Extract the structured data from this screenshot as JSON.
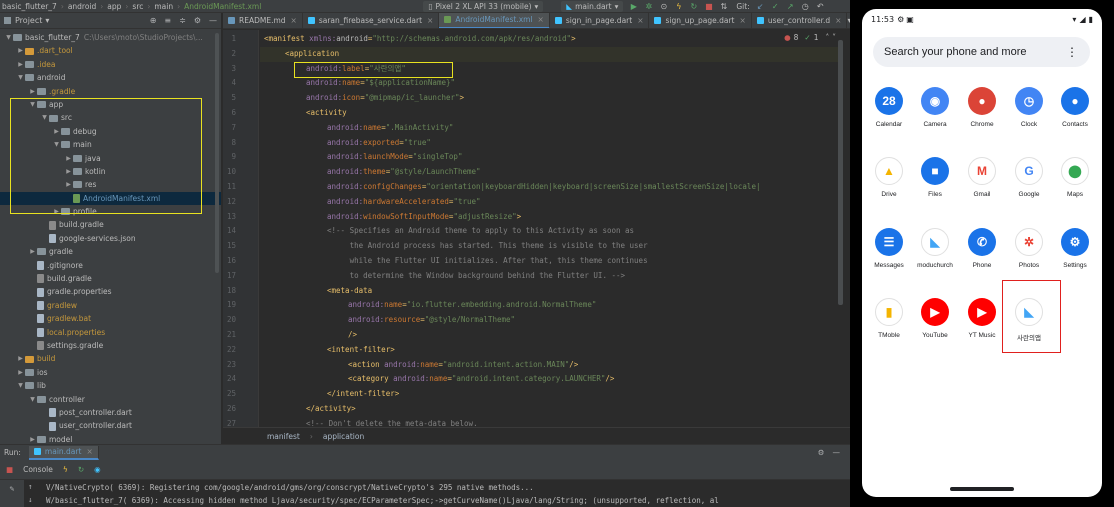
{
  "ide": {
    "navbar": {
      "crumbs": [
        "basic_flutter_7",
        "android",
        "app",
        "src",
        "main",
        "AndroidManifest.xml"
      ],
      "device": "Pixel 2 XL API 33 (mobile)",
      "run_config": "main.dart",
      "git_label": "Git:"
    },
    "project": {
      "title": "Project",
      "tree": [
        {
          "indent": 0,
          "arrow": "down",
          "icon": "folder",
          "label": "basic_flutter_7",
          "extra": "C:\\Users\\moto\\StudioProjects\\..."
        },
        {
          "indent": 1,
          "arrow": "right",
          "icon": "folder-orange",
          "label": ".dart_tool",
          "style": "orange"
        },
        {
          "indent": 1,
          "arrow": "right",
          "icon": "folder",
          "label": ".idea",
          "style": "orange"
        },
        {
          "indent": 1,
          "arrow": "down",
          "icon": "folder",
          "label": "android"
        },
        {
          "indent": 2,
          "arrow": "right",
          "icon": "folder",
          "label": ".gradle",
          "style": "orange"
        },
        {
          "indent": 2,
          "arrow": "down",
          "icon": "folder",
          "label": "app"
        },
        {
          "indent": 3,
          "arrow": "down",
          "icon": "folder",
          "label": "src"
        },
        {
          "indent": 4,
          "arrow": "right",
          "icon": "folder",
          "label": "debug"
        },
        {
          "indent": 4,
          "arrow": "down",
          "icon": "folder",
          "label": "main"
        },
        {
          "indent": 5,
          "arrow": "right",
          "icon": "folder",
          "label": "java"
        },
        {
          "indent": 5,
          "arrow": "right",
          "icon": "folder",
          "label": "kotlin"
        },
        {
          "indent": 5,
          "arrow": "right",
          "icon": "folder",
          "label": "res"
        },
        {
          "indent": 5,
          "arrow": "",
          "icon": "file-green",
          "label": "AndroidManifest.xml",
          "style": "blue",
          "selected": true
        },
        {
          "indent": 4,
          "arrow": "right",
          "icon": "folder",
          "label": "profile"
        },
        {
          "indent": 3,
          "arrow": "",
          "icon": "file-gray",
          "label": "build.gradle"
        },
        {
          "indent": 3,
          "arrow": "",
          "icon": "file",
          "label": "google-services.json"
        },
        {
          "indent": 2,
          "arrow": "right",
          "icon": "folder",
          "label": "gradle"
        },
        {
          "indent": 2,
          "arrow": "",
          "icon": "file",
          "label": ".gitignore"
        },
        {
          "indent": 2,
          "arrow": "",
          "icon": "file-gray",
          "label": "build.gradle"
        },
        {
          "indent": 2,
          "arrow": "",
          "icon": "file",
          "label": "gradle.properties"
        },
        {
          "indent": 2,
          "arrow": "",
          "icon": "file",
          "label": "gradlew",
          "style": "orange"
        },
        {
          "indent": 2,
          "arrow": "",
          "icon": "file",
          "label": "gradlew.bat",
          "style": "orange"
        },
        {
          "indent": 2,
          "arrow": "",
          "icon": "file",
          "label": "local.properties",
          "style": "orange"
        },
        {
          "indent": 2,
          "arrow": "",
          "icon": "file-gray",
          "label": "settings.gradle"
        },
        {
          "indent": 1,
          "arrow": "right",
          "icon": "folder-orange",
          "label": "build",
          "style": "orange"
        },
        {
          "indent": 1,
          "arrow": "right",
          "icon": "folder",
          "label": "ios"
        },
        {
          "indent": 1,
          "arrow": "down",
          "icon": "folder",
          "label": "lib"
        },
        {
          "indent": 2,
          "arrow": "down",
          "icon": "folder",
          "label": "controller"
        },
        {
          "indent": 3,
          "arrow": "",
          "icon": "file",
          "label": "post_controller.dart"
        },
        {
          "indent": 3,
          "arrow": "",
          "icon": "file",
          "label": "user_controller.dart"
        },
        {
          "indent": 2,
          "arrow": "right",
          "icon": "folder",
          "label": "model"
        }
      ]
    },
    "tabs": [
      {
        "label": "README.md",
        "color": "#6897bb"
      },
      {
        "label": "saran_firebase_service.dart",
        "color": "#40c4ff"
      },
      {
        "label": "AndroidManifest.xml",
        "color": "#6a9955",
        "active": true
      },
      {
        "label": "sign_in_page.dart",
        "color": "#40c4ff"
      },
      {
        "label": "sign_up_page.dart",
        "color": "#40c4ff"
      },
      {
        "label": "user_controller.d",
        "color": "#40c4ff"
      }
    ],
    "inspection": {
      "warnings": "8",
      "ok": "1"
    },
    "code_lines": [
      {
        "n": "1",
        "indent": 0,
        "parts": [
          [
            "t-tag",
            "<manifest "
          ],
          [
            "t-ns",
            "xmlns:"
          ],
          [
            "t-attr",
            "android"
          ],
          [
            "t-punct",
            "="
          ],
          [
            "t-str",
            "\"http://schemas.android.com/apk/res/android\""
          ],
          [
            "t-tag",
            ">"
          ]
        ]
      },
      {
        "n": "2",
        "indent": 1,
        "parts": [
          [
            "t-tag",
            "<application"
          ]
        ]
      },
      {
        "n": "3",
        "indent": 2,
        "parts": [
          [
            "t-ns",
            "android:"
          ],
          [
            "t-red",
            "label"
          ],
          [
            "t-punct",
            "="
          ],
          [
            "t-str",
            "\"사란의앱\""
          ]
        ]
      },
      {
        "n": "4",
        "indent": 2,
        "parts": [
          [
            "t-ns",
            "android:"
          ],
          [
            "t-red",
            "name"
          ],
          [
            "t-punct",
            "="
          ],
          [
            "t-str",
            "\"${applicationName}\""
          ]
        ]
      },
      {
        "n": "5",
        "indent": 2,
        "parts": [
          [
            "t-ns",
            "android:"
          ],
          [
            "t-red",
            "icon"
          ],
          [
            "t-punct",
            "="
          ],
          [
            "t-str",
            "\"@mipmap/ic_launcher\""
          ],
          [
            "t-tag",
            ">"
          ]
        ]
      },
      {
        "n": "6",
        "indent": 2,
        "parts": [
          [
            "t-tag",
            "<activity"
          ]
        ]
      },
      {
        "n": "7",
        "indent": 3,
        "parts": [
          [
            "t-ns",
            "android:"
          ],
          [
            "t-red",
            "name"
          ],
          [
            "t-punct",
            "="
          ],
          [
            "t-str",
            "\".MainActivity\""
          ]
        ]
      },
      {
        "n": "8",
        "indent": 3,
        "parts": [
          [
            "t-ns",
            "android:"
          ],
          [
            "t-red",
            "exported"
          ],
          [
            "t-punct",
            "="
          ],
          [
            "t-str",
            "\"true\""
          ]
        ]
      },
      {
        "n": "9",
        "indent": 3,
        "parts": [
          [
            "t-ns",
            "android:"
          ],
          [
            "t-red",
            "launchMode"
          ],
          [
            "t-punct",
            "="
          ],
          [
            "t-str",
            "\"singleTop\""
          ]
        ]
      },
      {
        "n": "10",
        "indent": 3,
        "parts": [
          [
            "t-ns",
            "android:"
          ],
          [
            "t-red",
            "theme"
          ],
          [
            "t-punct",
            "="
          ],
          [
            "t-str",
            "\"@style/LaunchTheme\""
          ]
        ]
      },
      {
        "n": "11",
        "indent": 3,
        "parts": [
          [
            "t-ns",
            "android:"
          ],
          [
            "t-red",
            "configChanges"
          ],
          [
            "t-punct",
            "="
          ],
          [
            "t-str",
            "\"orientation|keyboardHidden|keyboard|screenSize|smallestScreenSize|locale|"
          ]
        ]
      },
      {
        "n": "12",
        "indent": 3,
        "parts": [
          [
            "t-ns",
            "android:"
          ],
          [
            "t-red",
            "hardwareAccelerated"
          ],
          [
            "t-punct",
            "="
          ],
          [
            "t-str",
            "\"true\""
          ]
        ]
      },
      {
        "n": "13",
        "indent": 3,
        "parts": [
          [
            "t-ns",
            "android:"
          ],
          [
            "t-red",
            "windowSoftInputMode"
          ],
          [
            "t-punct",
            "="
          ],
          [
            "t-str",
            "\"adjustResize\""
          ],
          [
            "t-tag",
            ">"
          ]
        ]
      },
      {
        "n": "14",
        "indent": 3,
        "parts": [
          [
            "t-cmt",
            "<!-- Specifies an Android theme to apply to this Activity as soon as"
          ]
        ]
      },
      {
        "n": "15",
        "indent": 3,
        "parts": [
          [
            "t-cmt",
            "     the Android process has started. This theme is visible to the user"
          ]
        ]
      },
      {
        "n": "16",
        "indent": 3,
        "parts": [
          [
            "t-cmt",
            "     while the Flutter UI initializes. After that, this theme continues"
          ]
        ]
      },
      {
        "n": "17",
        "indent": 3,
        "parts": [
          [
            "t-cmt",
            "     to determine the Window background behind the Flutter UI. -->"
          ]
        ]
      },
      {
        "n": "18",
        "indent": 3,
        "parts": [
          [
            "t-tag",
            "<meta-data"
          ]
        ]
      },
      {
        "n": "19",
        "indent": 4,
        "parts": [
          [
            "t-ns",
            "android:"
          ],
          [
            "t-red",
            "name"
          ],
          [
            "t-punct",
            "="
          ],
          [
            "t-str",
            "\"io.flutter.embedding.android.NormalTheme\""
          ]
        ]
      },
      {
        "n": "20",
        "indent": 4,
        "parts": [
          [
            "t-ns",
            "android:"
          ],
          [
            "t-red",
            "resource"
          ],
          [
            "t-punct",
            "="
          ],
          [
            "t-str",
            "\"@style/NormalTheme\""
          ]
        ]
      },
      {
        "n": "21",
        "indent": 4,
        "parts": [
          [
            "t-tag",
            "/>"
          ]
        ]
      },
      {
        "n": "22",
        "indent": 3,
        "parts": [
          [
            "t-tag",
            "<intent-filter>"
          ]
        ]
      },
      {
        "n": "23",
        "indent": 4,
        "parts": [
          [
            "t-tag",
            "<action "
          ],
          [
            "t-ns",
            "android:"
          ],
          [
            "t-red",
            "name"
          ],
          [
            "t-punct",
            "="
          ],
          [
            "t-str",
            "\"android.intent.action.MAIN\""
          ],
          [
            "t-tag",
            "/>"
          ]
        ]
      },
      {
        "n": "24",
        "indent": 4,
        "parts": [
          [
            "t-tag",
            "<category "
          ],
          [
            "t-ns",
            "android:"
          ],
          [
            "t-red",
            "name"
          ],
          [
            "t-punct",
            "="
          ],
          [
            "t-str",
            "\"android.intent.category.LAUNCHER\""
          ],
          [
            "t-tag",
            "/>"
          ]
        ]
      },
      {
        "n": "25",
        "indent": 3,
        "parts": [
          [
            "t-tag",
            "</intent-filter>"
          ]
        ]
      },
      {
        "n": "26",
        "indent": 2,
        "parts": [
          [
            "t-tag",
            "</activity>"
          ]
        ]
      },
      {
        "n": "27",
        "indent": 2,
        "parts": [
          [
            "t-cmt",
            "<!-- Don't delete the meta-data below."
          ]
        ]
      }
    ],
    "breadcrumbs": [
      "manifest",
      "application"
    ],
    "run": {
      "label": "Run:",
      "config": "main.dart",
      "console_tab": "Console"
    },
    "console_lines": [
      "V/NativeCrypto( 6369): Registering com/google/android/gms/org/conscrypt/NativeCrypto's 295 native methods...",
      "W/basic_flutter_7( 6369): Accessing hidden method Ljava/security/spec/ECParameterSpec;->getCurveName()Ljava/lang/String; (unsupported, reflection, al"
    ]
  },
  "phone": {
    "time": "11:53",
    "search_placeholder": "Search your phone and more",
    "apps": [
      {
        "name": "Calendar",
        "icon": "calendar-icon",
        "bg": "#1a73e8",
        "glyph": "28"
      },
      {
        "name": "Camera",
        "icon": "camera-icon",
        "bg": "#4285f4",
        "glyph": "◉"
      },
      {
        "name": "Chrome",
        "icon": "chrome-icon",
        "bg": "#db4437",
        "glyph": "●"
      },
      {
        "name": "Clock",
        "icon": "clock-icon",
        "bg": "#4285f4",
        "glyph": "◷"
      },
      {
        "name": "Contacts",
        "icon": "contacts-icon",
        "bg": "#1a73e8",
        "glyph": "●"
      },
      {
        "name": "Drive",
        "icon": "drive-icon",
        "bg": "#ffffff",
        "glyph": "▲"
      },
      {
        "name": "Files",
        "icon": "files-icon",
        "bg": "#1a73e8",
        "glyph": "■"
      },
      {
        "name": "Gmail",
        "icon": "gmail-icon",
        "bg": "#ffffff",
        "glyph": "M"
      },
      {
        "name": "Google",
        "icon": "google-icon",
        "bg": "#ffffff",
        "glyph": "G"
      },
      {
        "name": "Maps",
        "icon": "maps-icon",
        "bg": "#ffffff",
        "glyph": "⬤"
      },
      {
        "name": "Messages",
        "icon": "messages-icon",
        "bg": "#1a73e8",
        "glyph": "☰"
      },
      {
        "name": "moduchurch",
        "icon": "flutter-icon",
        "bg": "#ffffff",
        "glyph": "◣"
      },
      {
        "name": "Phone",
        "icon": "phone-icon",
        "bg": "#1a73e8",
        "glyph": "✆"
      },
      {
        "name": "Photos",
        "icon": "photos-icon",
        "bg": "#ffffff",
        "glyph": "✲"
      },
      {
        "name": "Settings",
        "icon": "settings-icon",
        "bg": "#1a73e8",
        "glyph": "⚙"
      },
      {
        "name": "TMoble",
        "icon": "tmoble-icon",
        "bg": "#ffffff",
        "glyph": "▮"
      },
      {
        "name": "YouTube",
        "icon": "youtube-icon",
        "bg": "#ff0000",
        "glyph": "▶"
      },
      {
        "name": "YT Music",
        "icon": "yt-music-icon",
        "bg": "#ff0000",
        "glyph": "▶"
      },
      {
        "name": "사란의앱",
        "icon": "flutter-icon",
        "bg": "#ffffff",
        "glyph": "◣"
      }
    ]
  }
}
